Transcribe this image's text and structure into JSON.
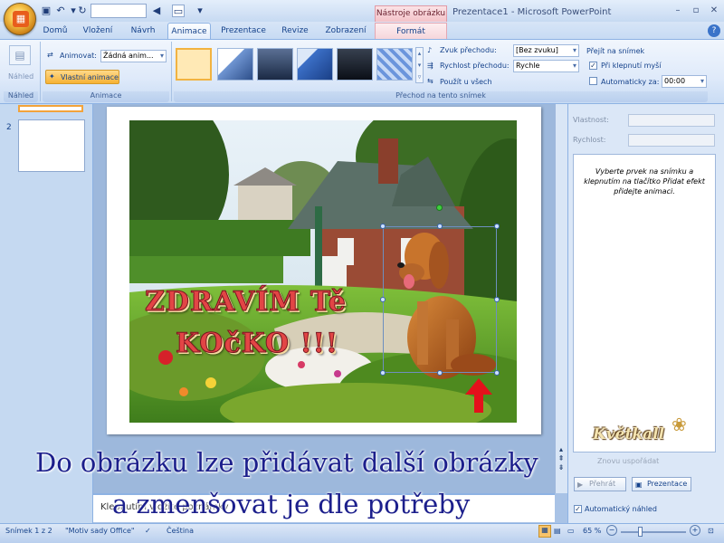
{
  "qat": {
    "save_icon": "save-icon",
    "undo_icon": "undo-icon",
    "redo_icon": "redo-icon"
  },
  "ribbon_tabs": [
    "Domů",
    "Vložení",
    "Návrh",
    "Animace",
    "Prezentace",
    "Revize",
    "Zobrazení",
    "Formát"
  ],
  "active_tab": "Animace",
  "context_tab_header": "Nástroje obrázku",
  "window_title": "Prezentace1 - Microsoft PowerPoint",
  "groups": {
    "preview": {
      "button": "Náhled",
      "label": "Náhled"
    },
    "animations": {
      "animate_label": "Animovat:",
      "animate_value": "Žádná anim...",
      "custom_button": "Vlastní animace",
      "label": "Animace"
    },
    "transition": {
      "sound_label": "Zvuk přechodu:",
      "sound_value": "[Bez zvuku]",
      "speed_label": "Rychlost přechodu:",
      "speed_value": "Rychle",
      "apply_all": "Použít u všech",
      "advance_header": "Přejít na snímek",
      "on_click": "Při klepnutí myší",
      "auto_after": "Automaticky za:",
      "auto_value": "00:00",
      "label": "Přechod na tento snímek"
    }
  },
  "slides_panel": {
    "slide_number": "2"
  },
  "slide": {
    "greeting_line1": "ZDRAVÍM Tě",
    "greeting_line2": "KOčKO !!!"
  },
  "captions": {
    "line1": "Do obrázku lze přidávat další obrázky",
    "line2": "a zmenšovat je dle potřeby"
  },
  "watermark": "Květkall",
  "notes_placeholder": "Klepnutím vložíte poznámky",
  "task_pane": {
    "property_label": "Vlastnost:",
    "speed_label": "Rychlost:",
    "hint": "Vyberte prvek na snímku a klepnutím na tlačítko Přidat efekt přidejte animaci.",
    "reorder": "Znovu uspořádat",
    "play_button": "Přehrát",
    "presentation_button": "Prezentace",
    "auto_preview": "Automatický náhled"
  },
  "status": {
    "slide_info": "Snímek 1 z 2",
    "theme": "\"Motiv sady Office\"",
    "language": "Čeština",
    "zoom": "65 %"
  }
}
